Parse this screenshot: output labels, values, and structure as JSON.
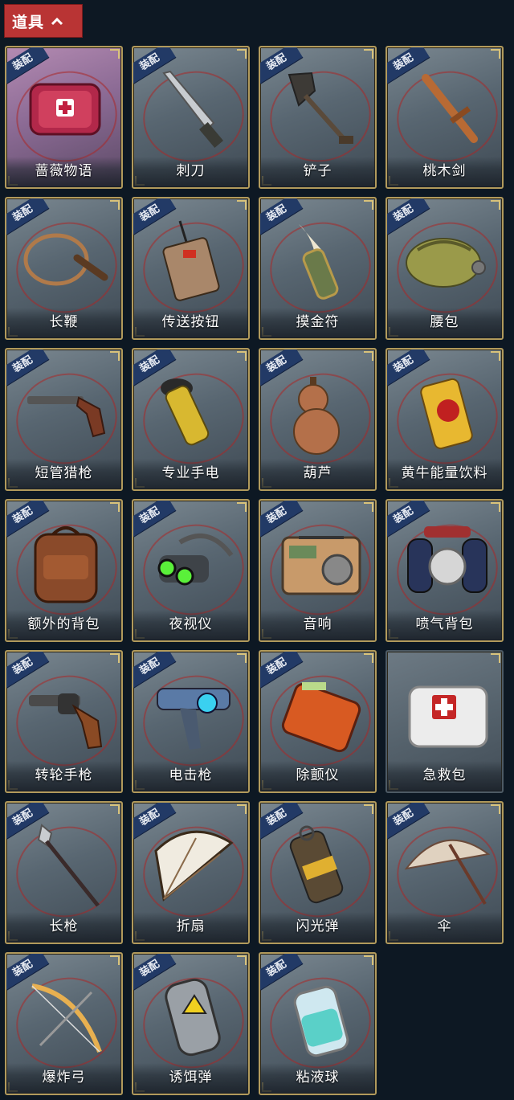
{
  "header": {
    "title": "道具",
    "icon": "chevron-up-icon",
    "color": "#b93434"
  },
  "equip_badge": "装配",
  "items": [
    {
      "name": "蔷薇物语",
      "icon": "pink-case-icon",
      "equip": true,
      "selected": true
    },
    {
      "name": "刺刀",
      "icon": "knife-icon",
      "equip": true
    },
    {
      "name": "铲子",
      "icon": "shovel-icon",
      "equip": true
    },
    {
      "name": "桃木剑",
      "icon": "wooden-sword-icon",
      "equip": true
    },
    {
      "name": "长鞭",
      "icon": "whip-icon",
      "equip": true
    },
    {
      "name": "传送按钮",
      "icon": "remote-button-icon",
      "equip": true
    },
    {
      "name": "摸金符",
      "icon": "talisman-icon",
      "equip": true
    },
    {
      "name": "腰包",
      "icon": "waist-bag-icon",
      "equip": true
    },
    {
      "name": "短管猎枪",
      "icon": "shotgun-icon",
      "equip": true
    },
    {
      "name": "专业手电",
      "icon": "flashlight-icon",
      "equip": true
    },
    {
      "name": "葫芦",
      "icon": "gourd-icon",
      "equip": true
    },
    {
      "name": "黄牛能量饮料",
      "icon": "energy-can-icon",
      "equip": true
    },
    {
      "name": "额外的背包",
      "icon": "backpack-icon",
      "equip": true
    },
    {
      "name": "夜视仪",
      "icon": "night-vision-icon",
      "equip": true
    },
    {
      "name": "音响",
      "icon": "radio-icon",
      "equip": true
    },
    {
      "name": "喷气背包",
      "icon": "jetpack-icon",
      "equip": true
    },
    {
      "name": "转轮手枪",
      "icon": "revolver-icon",
      "equip": true
    },
    {
      "name": "电击枪",
      "icon": "taser-gun-icon",
      "equip": true
    },
    {
      "name": "除颤仪",
      "icon": "defibrillator-icon",
      "equip": true
    },
    {
      "name": "急救包",
      "icon": "first-aid-kit-icon",
      "equip": false
    },
    {
      "name": "长枪",
      "icon": "spear-icon",
      "equip": true
    },
    {
      "name": "折扇",
      "icon": "folding-fan-icon",
      "equip": true
    },
    {
      "name": "闪光弹",
      "icon": "flashbang-icon",
      "equip": true
    },
    {
      "name": "伞",
      "icon": "umbrella-icon",
      "equip": true
    },
    {
      "name": "爆炸弓",
      "icon": "bow-icon",
      "equip": true
    },
    {
      "name": "诱饵弹",
      "icon": "decoy-grenade-icon",
      "equip": true
    },
    {
      "name": "粘液球",
      "icon": "slime-jar-icon",
      "equip": true
    }
  ]
}
